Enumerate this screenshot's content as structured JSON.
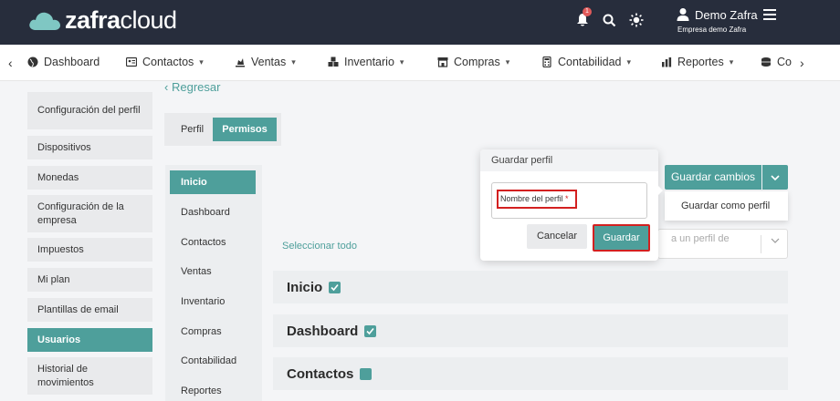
{
  "header": {
    "logo_bold": "zafra",
    "logo_light": "cloud",
    "notification_count": "1",
    "user_name": "Demo Zafra",
    "company": "Empresa demo Zafra"
  },
  "nav": {
    "items": [
      "Dashboard",
      "Contactos",
      "Ventas",
      "Inventario",
      "Compras",
      "Contabilidad",
      "Reportes",
      "Co"
    ]
  },
  "sidebar": {
    "items": [
      "Configuración del perfil",
      "Dispositivos",
      "Monedas",
      "Configuración de la empresa",
      "Impuestos",
      "Mi plan",
      "Plantillas de email",
      "Usuarios",
      "Historial de movimientos"
    ],
    "active": "Usuarios"
  },
  "main": {
    "back": "Regresar",
    "tabs": [
      "Perfil",
      "Permisos"
    ],
    "modules": [
      "Inicio",
      "Dashboard",
      "Contactos",
      "Ventas",
      "Inventario",
      "Compras",
      "Contabilidad",
      "Reportes"
    ],
    "select_all": "Seleccionar todo",
    "sections": [
      {
        "title": "Inicio",
        "checked": true
      },
      {
        "title": "Dashboard",
        "checked": true
      },
      {
        "title": "Contactos",
        "checked": false
      }
    ],
    "save_changes": "Guardar cambios",
    "save_as_profile": "Guardar como perfil",
    "base_profile_placeholder": "a un perfil de"
  },
  "popup": {
    "title": "Guardar perfil",
    "field_label": "Nombre del perfil",
    "required_mark": "*",
    "cancel": "Cancelar",
    "save": "Guardar"
  },
  "colors": {
    "accent": "#4e9f9b",
    "header_bg": "#272d3c",
    "highlight": "#d32020"
  }
}
